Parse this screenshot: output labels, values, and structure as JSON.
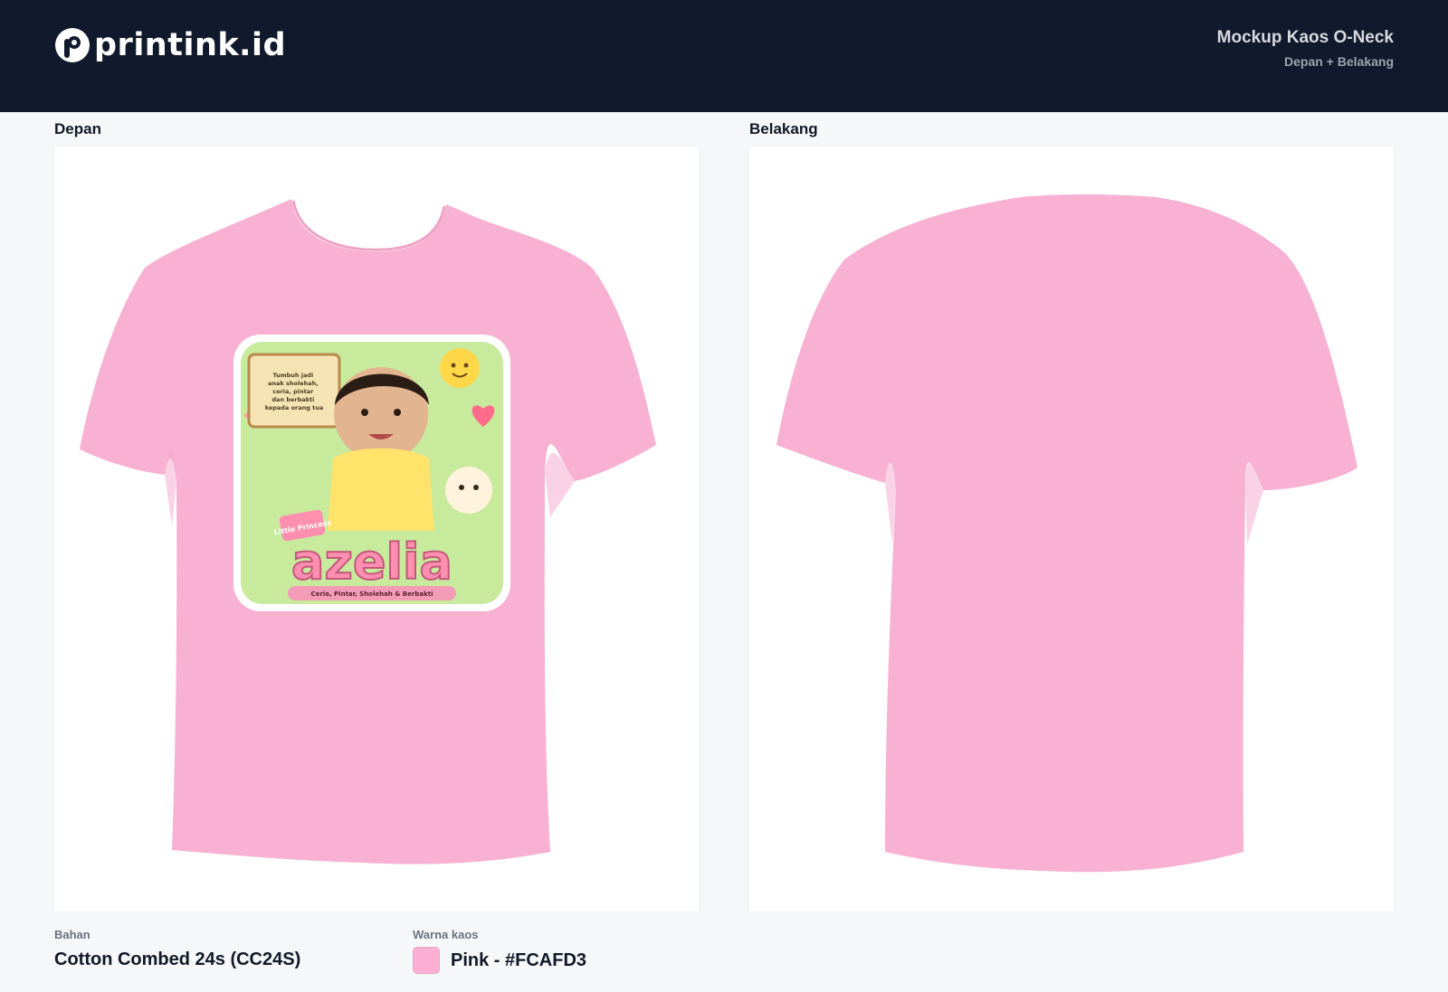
{
  "header": {
    "brand": "printink.id",
    "title": "Mockup Kaos O-Neck",
    "subtitle": "Depan + Belakang"
  },
  "front": {
    "label": "Depan",
    "design": {
      "note": "Tumbuh jadi anak sholehah, ceria, pintar dan berbakti kepada orang tua",
      "tag": "Little Princess",
      "name": "azelia",
      "tagline": "Ceria, Pintar, Sholehah & Berbakti"
    }
  },
  "back": {
    "label": "Belakang"
  },
  "details": {
    "material_label": "Bahan",
    "material_value": "Cotton Combed 24s (CC24S)",
    "color_label": "Warna kaos",
    "color_value": "Pink - #FCAFD3"
  },
  "colors": {
    "header_bg": "#111a2c",
    "shirt": "#F8B0D3",
    "swatch": "#FCAFD3"
  },
  "icons": {
    "logo": "printink-logo-icon"
  }
}
